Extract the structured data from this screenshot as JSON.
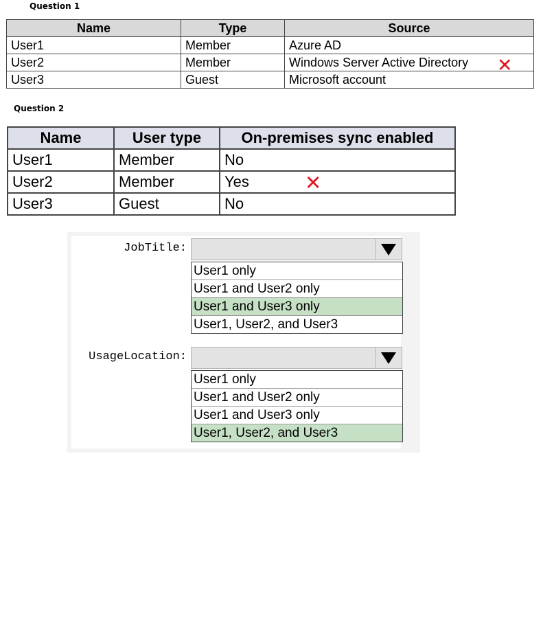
{
  "question1": {
    "label": "Question 1",
    "headers": [
      "Name",
      "Type",
      "Source"
    ],
    "rows": [
      [
        "User1",
        "Member",
        "Azure AD"
      ],
      [
        "User2",
        "Member",
        "Windows Server Active Directory"
      ],
      [
        "User3",
        "Guest",
        "Microsoft account"
      ]
    ],
    "mark": "✕"
  },
  "question2": {
    "label": "Question 2",
    "headers": [
      "Name",
      "User type",
      "On-premises sync enabled"
    ],
    "rows": [
      [
        "User1",
        "Member",
        "No"
      ],
      [
        "User2",
        "Member",
        "Yes"
      ],
      [
        "User3",
        "Guest",
        "No"
      ]
    ],
    "mark": "✕"
  },
  "answers": {
    "jobtitle": {
      "label": "JobTitle:",
      "options": [
        "User1 only",
        "User1 and User2 only",
        "User1 and User3 only",
        "User1, User2, and User3"
      ],
      "selected_index": 2
    },
    "usagelocation": {
      "label": "UsageLocation:",
      "options": [
        "User1 only",
        "User1 and User2 only",
        "User1 and User3 only",
        "User1, User2, and User3"
      ],
      "selected_index": 3
    },
    "highlight_color": "#c5e0c5",
    "mark_color": "#e0141e"
  }
}
